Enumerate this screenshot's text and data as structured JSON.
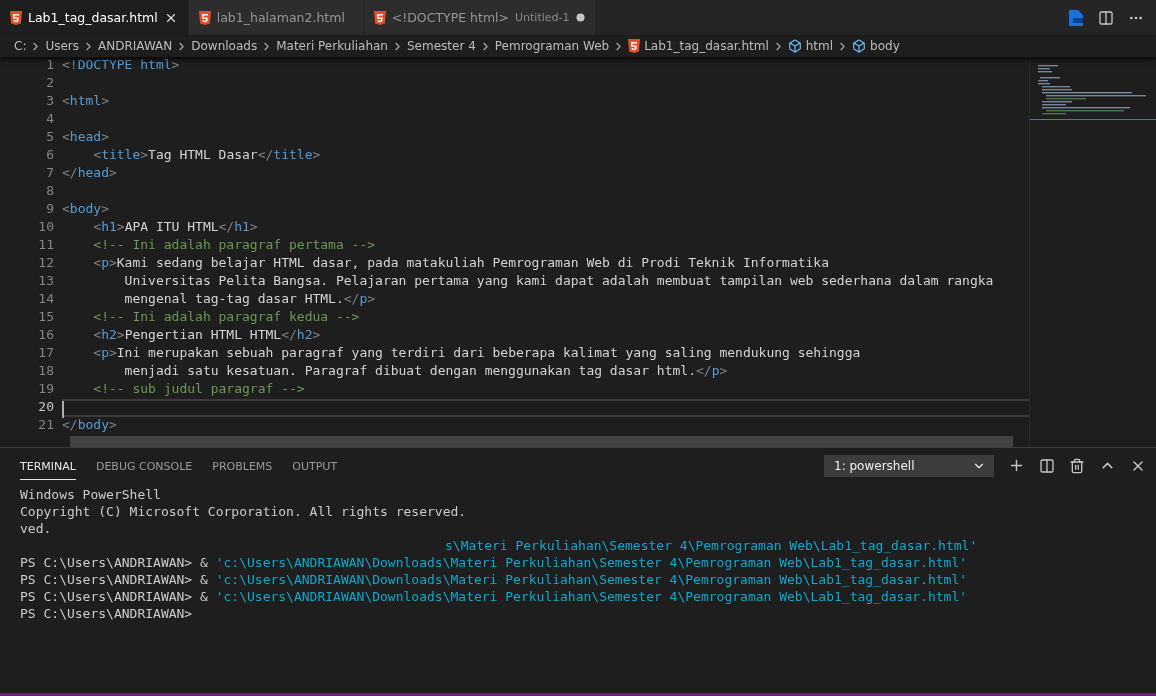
{
  "tabs": [
    {
      "label": "Lab1_tag_dasar.html",
      "selected": true,
      "dirty": false
    },
    {
      "label": "lab1_halaman2.html",
      "selected": false,
      "dirty": false
    },
    {
      "label": "<!DOCTYPE html>",
      "description": "Untitled-1",
      "selected": false,
      "dirty": true
    }
  ],
  "breadcrumb": [
    {
      "kind": "folder",
      "label": "C:"
    },
    {
      "kind": "folder",
      "label": "Users"
    },
    {
      "kind": "folder",
      "label": "ANDRIAWAN"
    },
    {
      "kind": "folder",
      "label": "Downloads"
    },
    {
      "kind": "folder",
      "label": "Materi Perkuliahan"
    },
    {
      "kind": "folder",
      "label": "Semester 4"
    },
    {
      "kind": "folder",
      "label": "Pemrograman Web"
    },
    {
      "kind": "file",
      "label": "Lab1_tag_dasar.html"
    },
    {
      "kind": "symbol",
      "label": "html"
    },
    {
      "kind": "symbol",
      "label": "body"
    }
  ],
  "editor": {
    "lines": [
      {
        "number": "1",
        "current": false,
        "tokens": [
          {
            "kind": "punct",
            "text": "<!"
          },
          {
            "kind": "tag",
            "text": "DOCTYPE html"
          },
          {
            "kind": "punct",
            "text": ">"
          }
        ]
      },
      {
        "number": "2",
        "current": false
      },
      {
        "number": "3",
        "current": false,
        "tokens": [
          {
            "kind": "punct",
            "text": "<"
          },
          {
            "kind": "tag",
            "text": "html"
          },
          {
            "kind": "punct",
            "text": ">"
          }
        ]
      },
      {
        "number": "4",
        "current": false
      },
      {
        "number": "5",
        "current": false,
        "tokens": [
          {
            "kind": "punct",
            "text": "<"
          },
          {
            "kind": "tag",
            "text": "head"
          },
          {
            "kind": "punct",
            "text": ">"
          }
        ]
      },
      {
        "number": "6",
        "current": false,
        "tokens": [
          {
            "kind": "punct",
            "text": "    <"
          },
          {
            "kind": "tag",
            "text": "title"
          },
          {
            "kind": "punct",
            "text": ">"
          },
          {
            "kind": "text",
            "text": "Tag HTML Dasar"
          },
          {
            "kind": "punct",
            "text": "</"
          },
          {
            "kind": "tag",
            "text": "title"
          },
          {
            "kind": "punct",
            "text": ">"
          }
        ]
      },
      {
        "number": "7",
        "current": false,
        "tokens": [
          {
            "kind": "punct",
            "text": "</"
          },
          {
            "kind": "tag",
            "text": "head"
          },
          {
            "kind": "punct",
            "text": ">"
          }
        ]
      },
      {
        "number": "8",
        "current": false
      },
      {
        "number": "9",
        "current": false,
        "tokens": [
          {
            "kind": "punct",
            "text": "<"
          },
          {
            "kind": "tag",
            "text": "body"
          },
          {
            "kind": "punct",
            "text": ">"
          }
        ]
      },
      {
        "number": "10",
        "current": false,
        "tokens": [
          {
            "kind": "punct",
            "text": "    <"
          },
          {
            "kind": "tag",
            "text": "h1"
          },
          {
            "kind": "punct",
            "text": ">"
          },
          {
            "kind": "text",
            "text": "APA ITU HTML"
          },
          {
            "kind": "punct",
            "text": "</"
          },
          {
            "kind": "tag",
            "text": "h1"
          },
          {
            "kind": "punct",
            "text": ">"
          }
        ]
      },
      {
        "number": "11",
        "current": false,
        "tokens": [
          {
            "kind": "comment",
            "text": "    <!-- Ini adalah paragraf pertama -->"
          }
        ]
      },
      {
        "number": "12",
        "current": false,
        "tokens": [
          {
            "kind": "punct",
            "text": "    <"
          },
          {
            "kind": "tag",
            "text": "p"
          },
          {
            "kind": "punct",
            "text": ">"
          },
          {
            "kind": "text",
            "text": "Kami sedang belajar HTML dasar, pada matakuliah Pemrograman Web di Prodi Teknik Informatika"
          }
        ]
      },
      {
        "number": "13",
        "current": false,
        "tokens": [
          {
            "kind": "text",
            "text": "        Universitas Pelita Bangsa. Pelajaran pertama yang kami dapat adalah membuat tampilan web sederhana dalam rangka"
          }
        ]
      },
      {
        "number": "14",
        "current": false,
        "tokens": [
          {
            "kind": "text",
            "text": "        mengenal tag-tag dasar HTML."
          },
          {
            "kind": "punct",
            "text": "</"
          },
          {
            "kind": "tag",
            "text": "p"
          },
          {
            "kind": "punct",
            "text": ">"
          }
        ]
      },
      {
        "number": "15",
        "current": false,
        "tokens": [
          {
            "kind": "comment",
            "text": "    <!-- Ini adalah paragraf kedua -->"
          }
        ]
      },
      {
        "number": "16",
        "current": false,
        "tokens": [
          {
            "kind": "punct",
            "text": "    <"
          },
          {
            "kind": "tag",
            "text": "h2"
          },
          {
            "kind": "punct",
            "text": ">"
          },
          {
            "kind": "text",
            "text": "Pengertian HTML HTML"
          },
          {
            "kind": "punct",
            "text": "</"
          },
          {
            "kind": "tag",
            "text": "h2"
          },
          {
            "kind": "punct",
            "text": ">"
          }
        ]
      },
      {
        "number": "17",
        "current": false,
        "tokens": [
          {
            "kind": "punct",
            "text": "    <"
          },
          {
            "kind": "tag",
            "text": "p"
          },
          {
            "kind": "punct",
            "text": ">"
          },
          {
            "kind": "text",
            "text": "Ini merupakan sebuah paragraf yang terdiri dari beberapa kalimat yang saling mendukung sehingga"
          }
        ]
      },
      {
        "number": "18",
        "current": false,
        "tokens": [
          {
            "kind": "text",
            "text": "        menjadi satu kesatuan. Paragraf dibuat dengan menggunakan tag dasar html."
          },
          {
            "kind": "punct",
            "text": "</"
          },
          {
            "kind": "tag",
            "text": "p"
          },
          {
            "kind": "punct",
            "text": ">"
          }
        ]
      },
      {
        "number": "19",
        "current": false,
        "tokens": [
          {
            "kind": "comment",
            "text": "    <!-- sub judul paragraf -->"
          }
        ]
      },
      {
        "number": "20",
        "current": true
      },
      {
        "number": "21",
        "current": false,
        "tokens": [
          {
            "kind": "punct",
            "text": "</"
          },
          {
            "kind": "tag",
            "text": "body"
          },
          {
            "kind": "punct",
            "text": ">"
          }
        ]
      }
    ]
  },
  "panel": {
    "tabs": [
      {
        "label": "TERMINAL",
        "selected": true
      },
      {
        "label": "DEBUG CONSOLE",
        "selected": false
      },
      {
        "label": "PROBLEMS",
        "selected": false
      },
      {
        "label": "OUTPUT",
        "selected": false
      }
    ],
    "terminal_select": "1: powershell",
    "lines": [
      {
        "kind": "plain",
        "text": "Windows PowerShell"
      },
      {
        "kind": "plain",
        "text": "Copyright (C) Microsoft Corporation. All rights reserved."
      },
      {
        "kind": "plain",
        "text": "ved."
      },
      {
        "kind": "fragment",
        "text": "s\\Materi Perkuliahan\\Semester 4\\Pemrograman Web\\Lab1_tag_dasar.html'"
      },
      {
        "kind": "command",
        "prompt": "PS C:\\Users\\ANDRIAWAN> &",
        "text": "'c:\\Users\\ANDRIAWAN\\Downloads\\Materi Perkuliahan\\Semester 4\\Pemrograman Web\\Lab1_tag_dasar.html'"
      },
      {
        "kind": "command",
        "prompt": "PS C:\\Users\\ANDRIAWAN> &",
        "text": "'c:\\Users\\ANDRIAWAN\\Downloads\\Materi Perkuliahan\\Semester 4\\Pemrograman Web\\Lab1_tag_dasar.html'"
      },
      {
        "kind": "command",
        "prompt": "PS C:\\Users\\ANDRIAWAN> &",
        "text": "'c:\\Users\\ANDRIAWAN\\Downloads\\Materi Perkuliahan\\Semester 4\\Pemrograman Web\\Lab1_tag_dasar.html'"
      },
      {
        "kind": "plain",
        "text": "PS C:\\Users\\ANDRIAWAN>"
      }
    ]
  }
}
